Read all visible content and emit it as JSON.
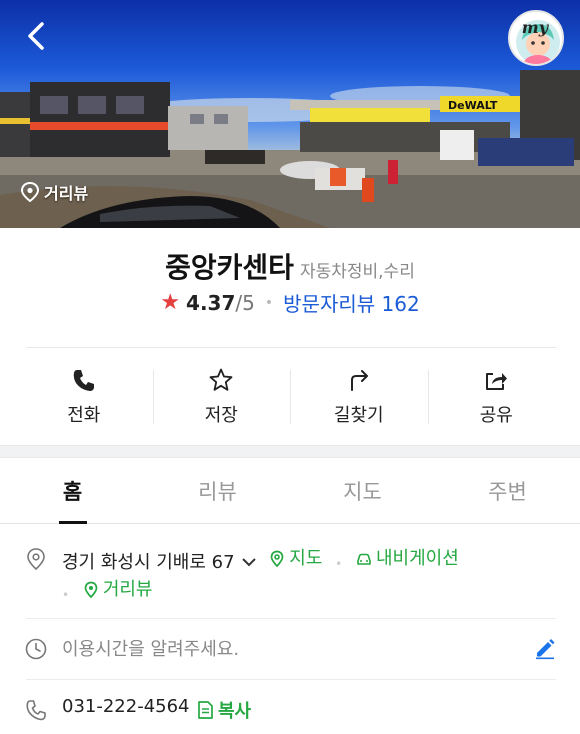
{
  "hero": {
    "my_label": "my",
    "street_view_label": "거리뷰",
    "sign_text": "DeWALT"
  },
  "place": {
    "name": "중앙카센타",
    "category": "자동차정비,수리",
    "rating": "4.37",
    "rating_max": "/5",
    "review_label": "방문자리뷰 162"
  },
  "actions": {
    "call": "전화",
    "save": "저장",
    "directions": "길찾기",
    "share": "공유"
  },
  "tabs": [
    "홈",
    "리뷰",
    "지도",
    "주변"
  ],
  "active_tab": "홈",
  "info": {
    "address": "경기 화성시 기배로 67",
    "map_link": "지도",
    "navigation_link": "내비게이션",
    "street_view_link": "거리뷰",
    "hours_placeholder": "이용시간을 알려주세요.",
    "phone": "031-222-4564",
    "copy_label": "복사"
  },
  "colors": {
    "accent_green": "#25a842",
    "link_blue": "#1a5bd6",
    "star_red": "#e54040"
  }
}
